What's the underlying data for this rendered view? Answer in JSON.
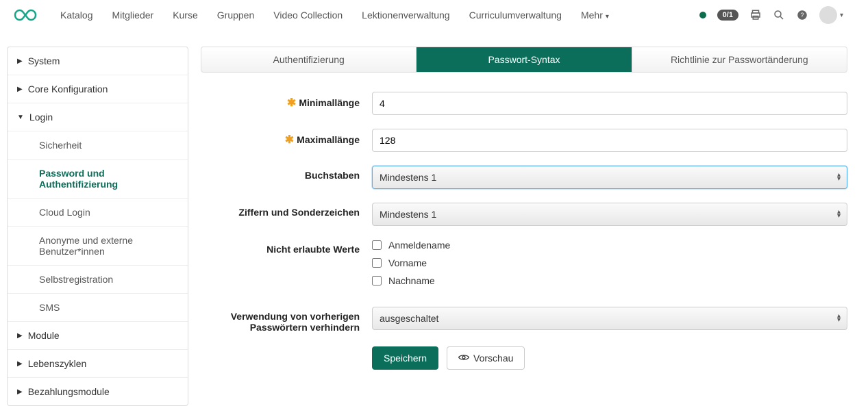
{
  "nav": {
    "items": [
      "Katalog",
      "Mitglieder",
      "Kurse",
      "Gruppen",
      "Video Collection",
      "Lektionenverwaltung",
      "Curriculumverwaltung"
    ],
    "more": "Mehr",
    "pill": "0/1"
  },
  "sidebar": {
    "system": "System",
    "core": "Core Konfiguration",
    "login": "Login",
    "login_children": {
      "sicherheit": "Sicherheit",
      "password_auth": "Password und Authentifizierung",
      "cloud": "Cloud Login",
      "anon": "Anonyme und externe Benutzer*innen",
      "selbst": "Selbstregistration",
      "sms": "SMS"
    },
    "module": "Module",
    "lebenszyklen": "Lebenszyklen",
    "bezahl": "Bezahlungsmodule"
  },
  "tabs": {
    "auth": "Authentifizierung",
    "syntax": "Passwort-Syntax",
    "policy": "Richtlinie zur Passwortänderung"
  },
  "form": {
    "min_label": "Minimallänge",
    "min_value": "4",
    "max_label": "Maximallänge",
    "max_value": "128",
    "letters_label": "Buchstaben",
    "letters_value": "Mindestens 1",
    "digits_label": "Ziffern und Sonderzeichen",
    "digits_value": "Mindestens 1",
    "forbidden_label": "Nicht erlaubte Werte",
    "forbidden_opts": {
      "login": "Anmeldename",
      "first": "Vorname",
      "last": "Nachname"
    },
    "history_label": "Verwendung von vorherigen Passwörtern verhindern",
    "history_value": "ausgeschaltet",
    "save": "Speichern",
    "preview": "Vorschau"
  }
}
